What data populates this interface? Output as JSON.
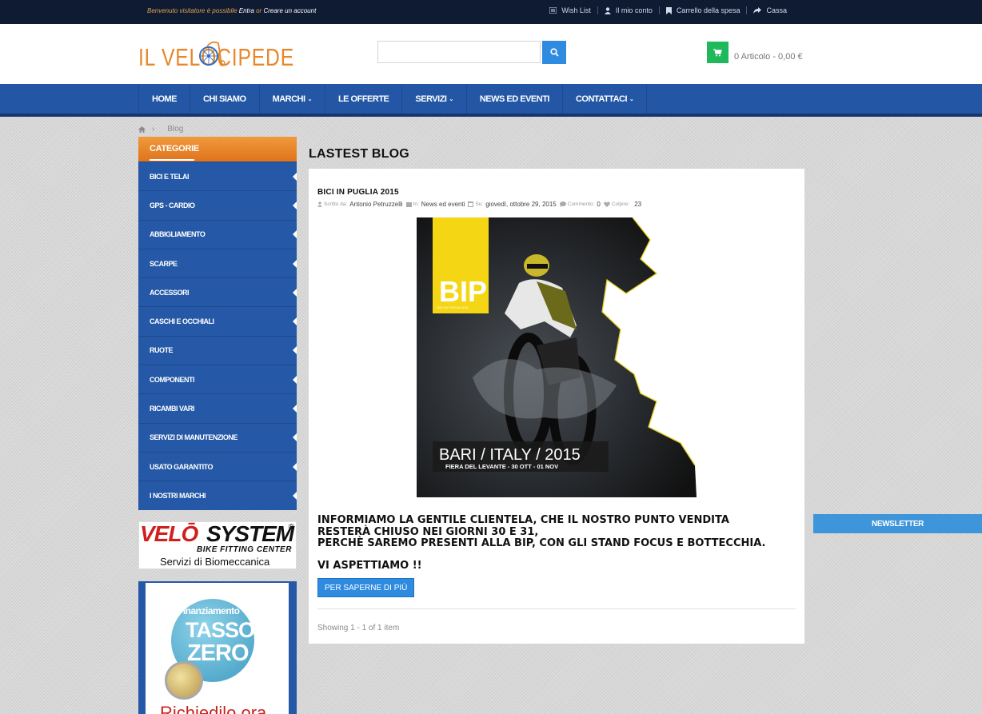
{
  "topbar": {
    "welcome_text": "Benvenuto visitatore è possibile",
    "login_link": "Entra",
    "or_text": "or",
    "register_link": "Creare un account",
    "links": [
      "Wish List",
      "Il mio conto",
      "Carrello della spesa",
      "Cassa"
    ]
  },
  "header": {
    "logo_text": "IL VELOCIPEDE",
    "search_placeholder": "",
    "cart_text": "0 Articolo - 0,00 €"
  },
  "nav": {
    "items": [
      {
        "label": "HOME",
        "dropdown": false
      },
      {
        "label": "CHI SIAMO",
        "dropdown": false
      },
      {
        "label": "MARCHI",
        "dropdown": true
      },
      {
        "label": "LE OFFERTE",
        "dropdown": false
      },
      {
        "label": "SERVIZI",
        "dropdown": true
      },
      {
        "label": "NEWS ED EVENTI",
        "dropdown": false
      },
      {
        "label": "CONTATTACI",
        "dropdown": true
      }
    ]
  },
  "breadcrumb": {
    "current": "Blog"
  },
  "sidebar": {
    "title": "CATEGORIE",
    "items": [
      {
        "label": "BICI E TELAI",
        "has_sub": true
      },
      {
        "label": "GPS - CARDIO",
        "has_sub": true
      },
      {
        "label": "ABBIGLIAMENTO",
        "has_sub": true
      },
      {
        "label": "SCARPE",
        "has_sub": true
      },
      {
        "label": "ACCESSORI",
        "has_sub": true
      },
      {
        "label": "CASCHI E OCCHIALI",
        "has_sub": true
      },
      {
        "label": "RUOTE",
        "has_sub": true
      },
      {
        "label": "COMPONENTI",
        "has_sub": true
      },
      {
        "label": "RICAMBI VARI",
        "has_sub": true
      },
      {
        "label": "SERVIZI DI MANUTENZIONE",
        "has_sub": true
      },
      {
        "label": "USATO GARANTITO",
        "has_sub": true
      },
      {
        "label": "I NOSTRI MARCHI",
        "has_sub": true
      }
    ],
    "velo_banner": {
      "brand_red": "VELŌ",
      "brand_black": "SYSTEM",
      "reg": "®",
      "tagline": "BIKE FITTING CENTER",
      "subtitle": "Servizi di Biomeccanica"
    },
    "fin_banner": {
      "line1": "Finanziamento",
      "line2": "TASSO",
      "line3": "ZERO",
      "line4": "Richiedilo ora"
    }
  },
  "main": {
    "title": "LASTEST BLOG",
    "post": {
      "title": "BICI IN PUGLIA 2015",
      "meta": {
        "author_label": "Scritto da:",
        "author": "Antonio Petruzzelli",
        "cat_label": "In:",
        "category": "News ed eventi",
        "date_label": "Su:",
        "date": "giovedì, ottobre 29, 2015",
        "comments_label": "Commento:",
        "comments": "0",
        "hits_label": "Colpire:",
        "hits": "23"
      },
      "poster": {
        "logo": "BIP",
        "logo_sub": "BICI IN PUGLIA 2015",
        "line1": "BARI / ITALY / 2015",
        "line2": "FIERA DEL LEVANTE - 30 OTT - 01 NOV"
      },
      "body": "INFORMIAMO LA GENTILE CLIENTELA, CHE IL NOSTRO PUNTO VENDITA RESTERÀ CHIUSO NEI GIORNI 30 E 31,\nPERCHÈ SAREMO PRESENTI ALLA BIP, CON GLI STAND FOCUS E BOTTECCHIA.",
      "closing": "VI ASPETTIAMO !!",
      "read_more": "PER SAPERNE DI PIÙ"
    },
    "showing": "Showing 1 - 1 of 1 item"
  },
  "newsletter": {
    "label": "NEWSLETTER"
  },
  "colors": {
    "topbar": "#0f1b33",
    "nav": "#2357a5",
    "accent_orange": "#e0731c",
    "button_blue": "#2f8be0",
    "cart_green": "#1fb95c"
  }
}
